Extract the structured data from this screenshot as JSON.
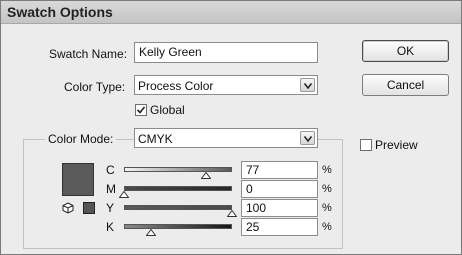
{
  "dialog": {
    "title": "Swatch Options"
  },
  "swatch_name": {
    "label": "Swatch Name:",
    "value": "Kelly Green"
  },
  "color_type": {
    "label": "Color Type:",
    "value": "Process Color"
  },
  "global": {
    "label": "Global",
    "checked": true
  },
  "color_mode": {
    "label": "Color Mode:",
    "value": "CMYK"
  },
  "preview": {
    "label": "Preview",
    "checked": false
  },
  "buttons": {
    "ok": "OK",
    "cancel": "Cancel"
  },
  "channels": [
    {
      "label": "C",
      "value": "77",
      "percent_sign": "%"
    },
    {
      "label": "M",
      "value": "0",
      "percent_sign": "%"
    },
    {
      "label": "Y",
      "value": "100",
      "percent_sign": "%"
    },
    {
      "label": "K",
      "value": "25",
      "percent_sign": "%"
    }
  ],
  "colors": {
    "swatch": "#5a5a5a"
  }
}
